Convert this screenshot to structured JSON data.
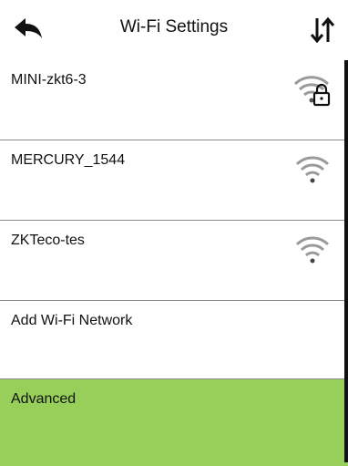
{
  "header": {
    "title": "Wi-Fi Settings",
    "back_icon": "back-arrow-icon",
    "sort_icon": "sort-icon"
  },
  "networks": [
    {
      "name": "MINI-zkt6-3",
      "icon": "wifi-lock-icon",
      "secured": true
    },
    {
      "name": "MERCURY_1544",
      "icon": "wifi-icon",
      "secured": false
    },
    {
      "name": "ZKTeco-tes",
      "icon": "wifi-icon",
      "secured": false
    }
  ],
  "actions": {
    "add_label": "Add Wi-Fi Network",
    "advanced_label": "Advanced"
  },
  "colors": {
    "highlight": "#98cf5a",
    "divider": "#8a8a8a",
    "wifi_gray": "#9a9a9a"
  }
}
